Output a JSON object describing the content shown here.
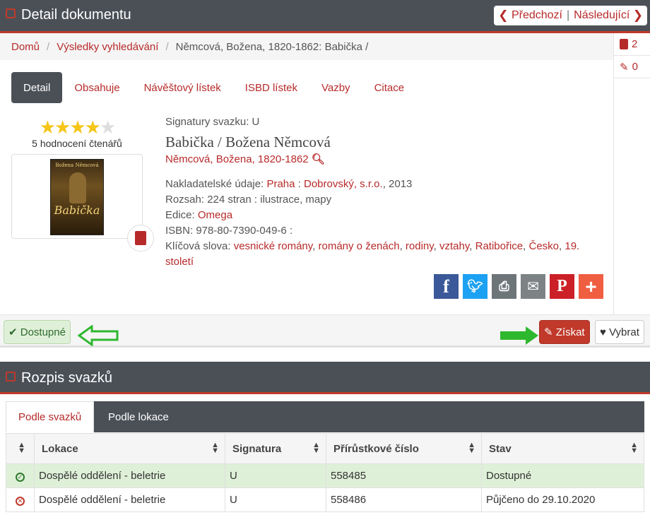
{
  "header": {
    "title": "Detail dokumentu",
    "prev_label": "Předchozí",
    "next_label": "Následující"
  },
  "breadcrumb": [
    "Domů",
    "Výsledky vyhledávání",
    "Němcová, Božena, 1820-1862: Babička /"
  ],
  "sidebar": {
    "items": [
      {
        "icon": "book-icon",
        "count": "2"
      },
      {
        "icon": "pencil-icon",
        "count": "0"
      }
    ]
  },
  "tabs": [
    "Detail",
    "Obsahuje",
    "Návěštový lístek",
    "ISBD lístek",
    "Vazby",
    "Citace"
  ],
  "rating": {
    "stars_filled": 4,
    "stars_total": 5,
    "count_text": "5 hodnocení čtenářů"
  },
  "cover": {
    "top_text": "Božena Němcová",
    "title_text": "Babička"
  },
  "record": {
    "signature_line": "Signatury svazku: U",
    "title": "Babička / Božena Němcová",
    "author": "Němcová, Božena, 1820-1862",
    "publisher_label": "Nakladatelské údaje:",
    "publisher_place": "Praha",
    "publisher_sep": " : ",
    "publisher_name": "Dobrovský, s.r.o.",
    "publisher_year": ", 2013",
    "extent": "Rozsah: 224 stran : ilustrace, mapy",
    "edition_label": "Edice:",
    "edition": "Omega",
    "isbn": "ISBN: 978-80-7390-049-6 :",
    "keywords_label": "Klíčová slova:",
    "keywords": [
      "vesnické romány",
      "romány o ženách",
      "rodiny",
      "vztahy",
      "Ratibořice",
      "Česko",
      "19. století"
    ]
  },
  "share": [
    "facebook",
    "twitter",
    "print",
    "email",
    "pinterest",
    "more"
  ],
  "availability": {
    "status_label": "Dostupné",
    "get_label": "Získat",
    "pick_label": "Vybrat"
  },
  "volumes": {
    "title": "Rozpis svazků",
    "tabs": [
      "Podle svazků",
      "Podle lokace"
    ],
    "columns": [
      "Lokace",
      "Signatura",
      "Přírůstkové číslo",
      "Stav"
    ],
    "rows": [
      {
        "status": "ok",
        "location": "Dospělé oddělení - beletrie",
        "signature": "U",
        "accession": "558485",
        "state": "Dostupné"
      },
      {
        "status": "lent",
        "location": "Dospělé oddělení - beletrie",
        "signature": "U",
        "accession": "558486",
        "state": "Půjčeno do 29.10.2020"
      }
    ]
  },
  "colors": {
    "accent": "#b72a2a",
    "header": "#4b5057",
    "available_bg": "#dff0d8",
    "arrow": "#2eb82e"
  }
}
